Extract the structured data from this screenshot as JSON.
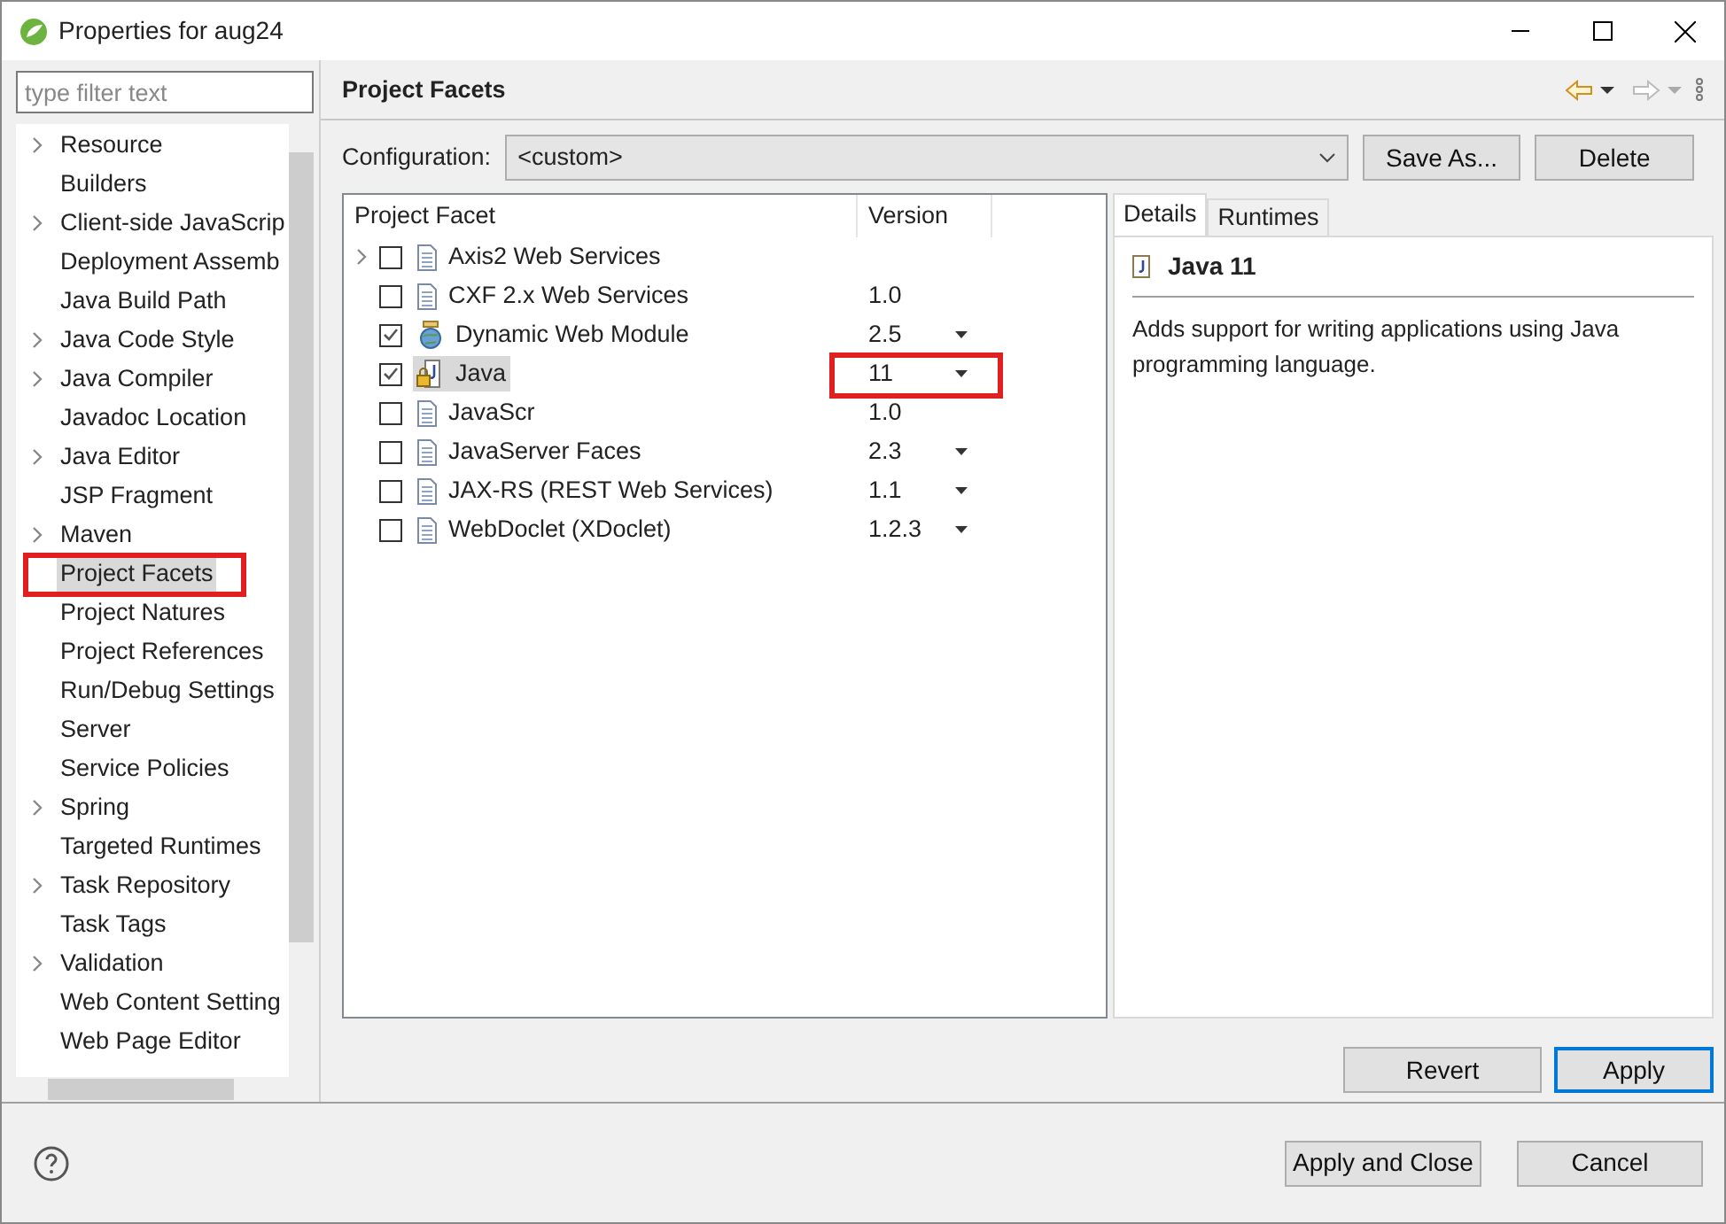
{
  "window": {
    "title": "Properties for aug24"
  },
  "filter": {
    "placeholder": "type filter text"
  },
  "sidebar": {
    "items": [
      {
        "label": "Resource",
        "expandable": true,
        "selected": false,
        "annotated": false
      },
      {
        "label": "Builders",
        "expandable": false,
        "selected": false,
        "annotated": false
      },
      {
        "label": "Client-side JavaScrip",
        "expandable": true,
        "selected": false,
        "annotated": false
      },
      {
        "label": "Deployment Assemb",
        "expandable": false,
        "selected": false,
        "annotated": false
      },
      {
        "label": "Java Build Path",
        "expandable": false,
        "selected": false,
        "annotated": false
      },
      {
        "label": "Java Code Style",
        "expandable": true,
        "selected": false,
        "annotated": false
      },
      {
        "label": "Java Compiler",
        "expandable": true,
        "selected": false,
        "annotated": false
      },
      {
        "label": "Javadoc Location",
        "expandable": false,
        "selected": false,
        "annotated": false
      },
      {
        "label": "Java Editor",
        "expandable": true,
        "selected": false,
        "annotated": false
      },
      {
        "label": "JSP Fragment",
        "expandable": false,
        "selected": false,
        "annotated": false
      },
      {
        "label": "Maven",
        "expandable": true,
        "selected": false,
        "annotated": false
      },
      {
        "label": "Project Facets",
        "expandable": false,
        "selected": true,
        "annotated": true
      },
      {
        "label": "Project Natures",
        "expandable": false,
        "selected": false,
        "annotated": false
      },
      {
        "label": "Project References",
        "expandable": false,
        "selected": false,
        "annotated": false
      },
      {
        "label": "Run/Debug Settings",
        "expandable": false,
        "selected": false,
        "annotated": false
      },
      {
        "label": "Server",
        "expandable": false,
        "selected": false,
        "annotated": false
      },
      {
        "label": "Service Policies",
        "expandable": false,
        "selected": false,
        "annotated": false
      },
      {
        "label": "Spring",
        "expandable": true,
        "selected": false,
        "annotated": false
      },
      {
        "label": "Targeted Runtimes",
        "expandable": false,
        "selected": false,
        "annotated": false
      },
      {
        "label": "Task Repository",
        "expandable": true,
        "selected": false,
        "annotated": false
      },
      {
        "label": "Task Tags",
        "expandable": false,
        "selected": false,
        "annotated": false
      },
      {
        "label": "Validation",
        "expandable": true,
        "selected": false,
        "annotated": false
      },
      {
        "label": "Web Content Setting",
        "expandable": false,
        "selected": false,
        "annotated": false
      },
      {
        "label": "Web Page Editor",
        "expandable": false,
        "selected": false,
        "annotated": false
      }
    ]
  },
  "page": {
    "title": "Project Facets",
    "configuration_label": "Configuration:",
    "configuration_value": "<custom>",
    "buttons": [
      "Save As...",
      "Delete"
    ]
  },
  "table": {
    "columns": [
      "Project Facet",
      "Version"
    ],
    "rows": [
      {
        "name": "Axis2 Web Services",
        "version": "",
        "checked": false,
        "expandable": true,
        "selected": false,
        "has_dropdown": false,
        "annotated": false,
        "kind": "doc"
      },
      {
        "name": "CXF 2.x Web Services",
        "version": "1.0",
        "checked": false,
        "expandable": false,
        "selected": false,
        "has_dropdown": false,
        "annotated": false,
        "kind": "doc"
      },
      {
        "name": "Dynamic Web Module",
        "version": "2.5",
        "checked": true,
        "expandable": false,
        "selected": false,
        "has_dropdown": true,
        "annotated": false,
        "kind": "globe"
      },
      {
        "name": "Java",
        "version": "11",
        "checked": true,
        "expandable": false,
        "selected": true,
        "has_dropdown": true,
        "annotated": true,
        "kind": "java"
      },
      {
        "name": "JavaScr",
        "version": "1.0",
        "checked": false,
        "expandable": false,
        "selected": false,
        "has_dropdown": false,
        "annotated": false,
        "kind": "doc"
      },
      {
        "name": "JavaServer Faces",
        "version": "2.3",
        "checked": false,
        "expandable": false,
        "selected": false,
        "has_dropdown": true,
        "annotated": false,
        "kind": "doc"
      },
      {
        "name": "JAX-RS (REST Web Services)",
        "version": "1.1",
        "checked": false,
        "expandable": false,
        "selected": false,
        "has_dropdown": true,
        "annotated": false,
        "kind": "doc"
      },
      {
        "name": "WebDoclet (XDoclet)",
        "version": "1.2.3",
        "checked": false,
        "expandable": false,
        "selected": false,
        "has_dropdown": true,
        "annotated": false,
        "kind": "doc"
      }
    ]
  },
  "details": {
    "tabs": [
      {
        "label": "Details",
        "selected": true
      },
      {
        "label": "Runtimes",
        "selected": false
      }
    ],
    "title": "Java 11",
    "description": "Adds support for writing applications using Java programming language."
  },
  "page_buttons": [
    "Revert",
    "Apply"
  ],
  "footer_buttons": [
    "Apply and Close",
    "Cancel"
  ]
}
